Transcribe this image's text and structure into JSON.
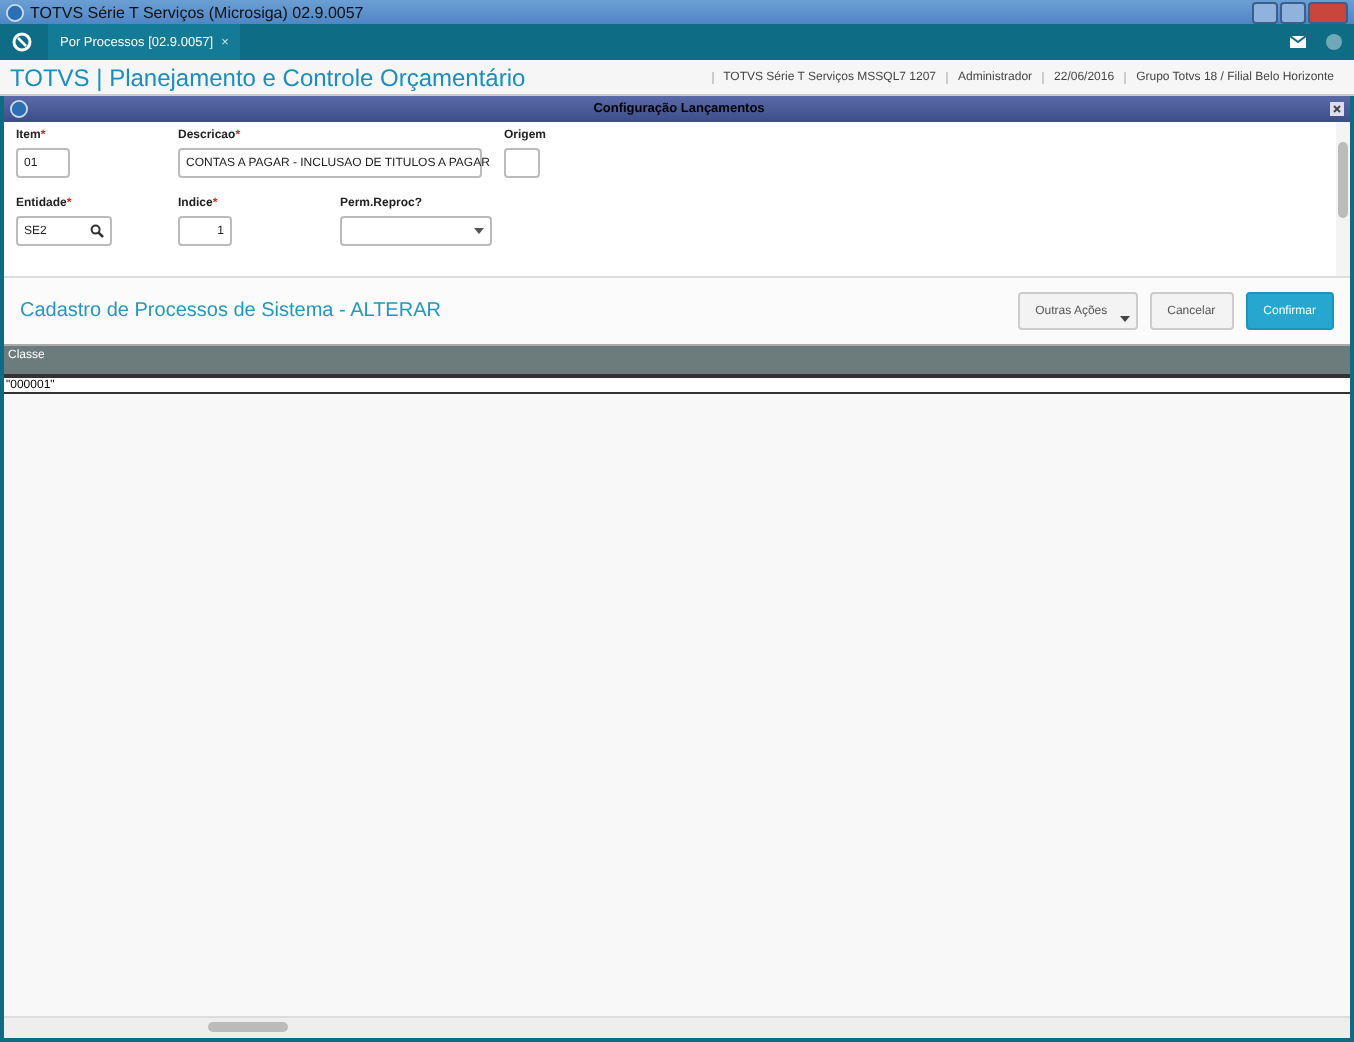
{
  "window": {
    "title": "TOTVS Série T Serviços (Microsiga) 02.9.0057"
  },
  "tabs": [
    {
      "label": "Por Processos [02.9.0057]",
      "selected": true,
      "close": "×"
    }
  ],
  "app_header": {
    "title": "TOTVS | Planejamento e Controle Orçamentário",
    "info": [
      "TOTVS Série T Serviços MSSQL7 1207",
      "Administrador",
      "22/06/2016",
      "Grupo Totvs 18 / Filial Belo Horizonte"
    ]
  },
  "dialog": {
    "title": "Configuração Lançamentos",
    "fields": [
      {
        "kind": "text",
        "label": "Item",
        "required_mark": "*",
        "value": "01"
      },
      {
        "kind": "text",
        "label": "Descricao",
        "required_mark": "*",
        "value": "CONTAS A PAGAR - INCLUSAO DE TITULOS A PAGAR"
      },
      {
        "kind": "text",
        "label": "Origem"
      },
      {
        "kind": "lookup",
        "label": "Entidade",
        "required_mark": "*",
        "value": "SE2"
      },
      {
        "kind": "number",
        "label": "Indice",
        "required_mark": "*",
        "value": "1"
      },
      {
        "kind": "select",
        "label": "Perm.Reproc?"
      }
    ]
  },
  "process": {
    "title": "Cadastro de Processos de Sistema - ALTERAR",
    "buttons": [
      {
        "label": "Outras Ações",
        "kind": "menu"
      },
      {
        "label": "Cancelar",
        "kind": "plain"
      },
      {
        "label": "Confirmar",
        "kind": "primary"
      }
    ]
  },
  "table": {
    "columns": [
      "Classe"
    ],
    "rows": [
      [
        "\"000001\""
      ]
    ]
  }
}
